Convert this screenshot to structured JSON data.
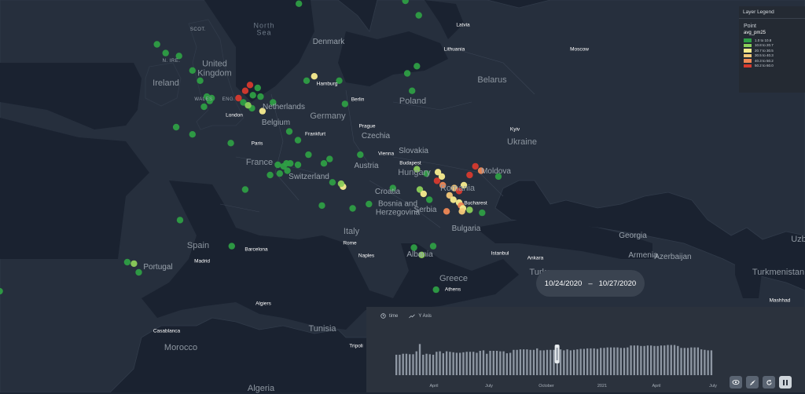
{
  "map": {
    "country_labels": [
      {
        "id": "north-sea",
        "text": "North\nSea",
        "kind": "sea"
      },
      {
        "id": "denmark",
        "text": "Denmark",
        "kind": "country"
      },
      {
        "id": "latvia",
        "text": "Latvia",
        "kind": "city"
      },
      {
        "id": "lithuania",
        "text": "Lithuania",
        "kind": "city"
      },
      {
        "id": "scot",
        "text": "SCOT.",
        "kind": "region"
      },
      {
        "id": "n-ire",
        "text": "N. IRE.",
        "kind": "region"
      },
      {
        "id": "wales",
        "text": "WALES",
        "kind": "region"
      },
      {
        "id": "eng",
        "text": "ENG.",
        "kind": "region"
      },
      {
        "id": "united-kingdom",
        "text": "United\nKingdom",
        "kind": "country-lg"
      },
      {
        "id": "ireland",
        "text": "Ireland",
        "kind": "country-lg"
      },
      {
        "id": "belarus",
        "text": "Belarus",
        "kind": "country-lg"
      },
      {
        "id": "poland",
        "text": "Poland",
        "kind": "country-lg"
      },
      {
        "id": "germany",
        "text": "Germany",
        "kind": "country-lg"
      },
      {
        "id": "netherlands",
        "text": "Netherlands",
        "kind": "country"
      },
      {
        "id": "belgium",
        "text": "Belgium",
        "kind": "country"
      },
      {
        "id": "czechia",
        "text": "Czechia",
        "kind": "country"
      },
      {
        "id": "slovakia",
        "text": "Slovakia",
        "kind": "country"
      },
      {
        "id": "ukraine",
        "text": "Ukraine",
        "kind": "country-lg"
      },
      {
        "id": "france",
        "text": "France",
        "kind": "country-lg"
      },
      {
        "id": "austria",
        "text": "Austria",
        "kind": "country"
      },
      {
        "id": "switzerland",
        "text": "Switzerland",
        "kind": "country"
      },
      {
        "id": "hungary",
        "text": "Hungary",
        "kind": "country-lg"
      },
      {
        "id": "romania",
        "text": "Romania",
        "kind": "country-lg"
      },
      {
        "id": "moldova",
        "text": "Moldova",
        "kind": "country"
      },
      {
        "id": "croatia",
        "text": "Croatia",
        "kind": "country"
      },
      {
        "id": "bosnia",
        "text": "Bosnia and\nHerzegovina",
        "kind": "country"
      },
      {
        "id": "serbia",
        "text": "Serbia",
        "kind": "country"
      },
      {
        "id": "bulgaria",
        "text": "Bulgaria",
        "kind": "country"
      },
      {
        "id": "italy",
        "text": "Italy",
        "kind": "country-lg"
      },
      {
        "id": "spain",
        "text": "Spain",
        "kind": "country-lg"
      },
      {
        "id": "portugal",
        "text": "Portugal",
        "kind": "country"
      },
      {
        "id": "albania",
        "text": "Albania",
        "kind": "country"
      },
      {
        "id": "greece",
        "text": "Greece",
        "kind": "country-lg"
      },
      {
        "id": "turkey",
        "text": "Turkey",
        "kind": "country-lg"
      },
      {
        "id": "georgia",
        "text": "Georgia",
        "kind": "country"
      },
      {
        "id": "armenia",
        "text": "Armenia",
        "kind": "country"
      },
      {
        "id": "azerbaijan",
        "text": "Azerbaijan",
        "kind": "country"
      },
      {
        "id": "turkmenistan",
        "text": "Turkmenistan",
        "kind": "country-lg"
      },
      {
        "id": "morocco",
        "text": "Morocco",
        "kind": "country-lg"
      },
      {
        "id": "tunisia",
        "text": "Tunisia",
        "kind": "country-lg"
      },
      {
        "id": "algeria",
        "text": "Algeria",
        "kind": "country-lg"
      },
      {
        "id": "uzbek",
        "text": "Uzb",
        "kind": "country-lg"
      }
    ],
    "city_labels": [
      {
        "id": "moscow",
        "text": "Moscow"
      },
      {
        "id": "hamburg",
        "text": "Hamburg"
      },
      {
        "id": "berlin",
        "text": "Berlin"
      },
      {
        "id": "london",
        "text": "London"
      },
      {
        "id": "prague",
        "text": "Prague"
      },
      {
        "id": "frankfurt",
        "text": "Frankfurt"
      },
      {
        "id": "kyiv",
        "text": "Kyiv"
      },
      {
        "id": "paris",
        "text": "Paris"
      },
      {
        "id": "vienna",
        "text": "Vienna"
      },
      {
        "id": "budapest",
        "text": "Budapest"
      },
      {
        "id": "bucharest",
        "text": "Bucharest"
      },
      {
        "id": "madrid",
        "text": "Madrid"
      },
      {
        "id": "barcelona",
        "text": "Barcelona"
      },
      {
        "id": "rome",
        "text": "Rome"
      },
      {
        "id": "naples",
        "text": "Naples"
      },
      {
        "id": "istanbul",
        "text": "Istanbul"
      },
      {
        "id": "ankara",
        "text": "Ankara"
      },
      {
        "id": "athens",
        "text": "Athens"
      },
      {
        "id": "algiers",
        "text": "Algiers"
      },
      {
        "id": "casablanca",
        "text": "Casablanca"
      },
      {
        "id": "tripoli",
        "text": "Tripoli"
      },
      {
        "id": "mashhad",
        "text": "Mashhad"
      }
    ],
    "points": [
      {
        "lon": 19.2,
        "lat": 69.6,
        "bin": 0
      },
      {
        "lon": 19.0,
        "lat": 69.9,
        "bin": 0
      },
      {
        "lon": 18.3,
        "lat": 67.4,
        "bin": 0
      },
      {
        "lon": 9.8,
        "lat": 64.1,
        "bin": 0
      },
      {
        "lon": 14.5,
        "lat": 63.2,
        "bin": 0
      },
      {
        "lon": 13.8,
        "lat": 62.5,
        "bin": 0
      },
      {
        "lon": 1.0,
        "lat": 70.9,
        "bin": 0
      },
      {
        "lon": 9.5,
        "lat": 59.9,
        "bin": 0
      },
      {
        "lon": 9.2,
        "lat": 58.3,
        "bin": 0
      },
      {
        "lon": 20.3,
        "lat": 58.5,
        "bin": 0
      },
      {
        "lon": 21.7,
        "lat": 57.5,
        "bin": 0
      },
      {
        "lon": 21.5,
        "lat": 54.0,
        "bin": 0
      },
      {
        "lon": 20.5,
        "lat": 53.5,
        "bin": 0
      },
      {
        "lon": -5.6,
        "lat": 55.5,
        "bin": 0
      },
      {
        "lon": -4.7,
        "lat": 54.9,
        "bin": 0
      },
      {
        "lon": -3.3,
        "lat": 54.7,
        "bin": 0
      },
      {
        "lon": -1.9,
        "lat": 53.7,
        "bin": 0
      },
      {
        "lon": -1.1,
        "lat": 53.0,
        "bin": 0
      },
      {
        "lon": -0.4,
        "lat": 51.9,
        "bin": 0
      },
      {
        "lon": -0.1,
        "lat": 51.6,
        "bin": 0
      },
      {
        "lon": 0.1,
        "lat": 51.8,
        "bin": 0
      },
      {
        "lon": -0.7,
        "lat": 51.2,
        "bin": 0
      },
      {
        "lon": 2.9,
        "lat": 51.8,
        "bin": 5
      },
      {
        "lon": 3.6,
        "lat": 52.3,
        "bin": 5
      },
      {
        "lon": 4.1,
        "lat": 52.7,
        "bin": 5
      },
      {
        "lon": 3.4,
        "lat": 51.5,
        "bin": 0
      },
      {
        "lon": 4.4,
        "lat": 52.0,
        "bin": 0
      },
      {
        "lon": 4.9,
        "lat": 52.5,
        "bin": 0
      },
      {
        "lon": 5.2,
        "lat": 51.9,
        "bin": 0
      },
      {
        "lon": 4.3,
        "lat": 51.1,
        "bin": 0
      },
      {
        "lon": 5.4,
        "lat": 50.9,
        "bin": 2
      },
      {
        "lon": 3.9,
        "lat": 51.3,
        "bin": 1
      },
      {
        "lon": 6.5,
        "lat": 51.5,
        "bin": 0
      },
      {
        "lon": 10.0,
        "lat": 53.0,
        "bin": 0
      },
      {
        "lon": 10.8,
        "lat": 53.3,
        "bin": 2
      },
      {
        "lon": 13.4,
        "lat": 53.0,
        "bin": 0
      },
      {
        "lon": 14.0,
        "lat": 51.4,
        "bin": 0
      },
      {
        "lon": 21.0,
        "lat": 52.3,
        "bin": 0
      },
      {
        "lon": -3.6,
        "lat": 49.8,
        "bin": 0
      },
      {
        "lon": -1.9,
        "lat": 49.3,
        "bin": 0
      },
      {
        "lon": 2.1,
        "lat": 48.7,
        "bin": 0
      },
      {
        "lon": 8.2,
        "lat": 49.5,
        "bin": 0
      },
      {
        "lon": 9.1,
        "lat": 48.9,
        "bin": 0
      },
      {
        "lon": 10.2,
        "lat": 47.9,
        "bin": 0
      },
      {
        "lon": 9.1,
        "lat": 47.2,
        "bin": 0
      },
      {
        "lon": 8.3,
        "lat": 47.3,
        "bin": 0
      },
      {
        "lon": 7.6,
        "lat": 47.1,
        "bin": 0
      },
      {
        "lon": 7.9,
        "lat": 47.3,
        "bin": 0
      },
      {
        "lon": 8.0,
        "lat": 46.8,
        "bin": 0
      },
      {
        "lon": 7.2,
        "lat": 46.6,
        "bin": 0
      },
      {
        "lon": 7.0,
        "lat": 47.2,
        "bin": 0
      },
      {
        "lon": 6.2,
        "lat": 46.5,
        "bin": 0
      },
      {
        "lon": 12.4,
        "lat": 47.6,
        "bin": 0
      },
      {
        "lon": 11.8,
        "lat": 47.3,
        "bin": 0
      },
      {
        "lon": 15.6,
        "lat": 47.9,
        "bin": 0
      },
      {
        "lon": 19.0,
        "lat": 45.6,
        "bin": 0
      },
      {
        "lon": 13.8,
        "lat": 45.7,
        "bin": 2
      },
      {
        "lon": 13.6,
        "lat": 45.9,
        "bin": 1
      },
      {
        "lon": 12.7,
        "lat": 46.0,
        "bin": 0
      },
      {
        "lon": 14.8,
        "lat": 44.2,
        "bin": 0
      },
      {
        "lon": 16.5,
        "lat": 44.5,
        "bin": 0
      },
      {
        "lon": 11.6,
        "lat": 44.4,
        "bin": 0
      },
      {
        "lon": 3.6,
        "lat": 45.5,
        "bin": 0
      },
      {
        "lon": -3.2,
        "lat": 43.4,
        "bin": 0
      },
      {
        "lon": 2.2,
        "lat": 41.6,
        "bin": 0
      },
      {
        "lon": -8.7,
        "lat": 40.5,
        "bin": 0
      },
      {
        "lon": -8.0,
        "lat": 40.4,
        "bin": 1
      },
      {
        "lon": -7.5,
        "lat": 39.8,
        "bin": 0
      },
      {
        "lon": -22.0,
        "lat": 38.5,
        "bin": 0
      },
      {
        "lon": 21.5,
        "lat": 46.9,
        "bin": 1
      },
      {
        "lon": 22.5,
        "lat": 46.6,
        "bin": 0
      },
      {
        "lon": 23.7,
        "lat": 46.7,
        "bin": 2
      },
      {
        "lon": 23.6,
        "lat": 46.1,
        "bin": 5
      },
      {
        "lon": 24.1,
        "lat": 46.4,
        "bin": 2
      },
      {
        "lon": 24.2,
        "lat": 45.8,
        "bin": 4
      },
      {
        "lon": 25.4,
        "lat": 45.6,
        "bin": 3
      },
      {
        "lon": 25.9,
        "lat": 45.4,
        "bin": 5
      },
      {
        "lon": 26.4,
        "lat": 45.8,
        "bin": 2
      },
      {
        "lon": 27.0,
        "lat": 46.5,
        "bin": 5
      },
      {
        "lon": 27.6,
        "lat": 47.1,
        "bin": 5
      },
      {
        "lon": 28.2,
        "lat": 46.8,
        "bin": 4
      },
      {
        "lon": 30.0,
        "lat": 46.4,
        "bin": 0
      },
      {
        "lon": 21.8,
        "lat": 45.5,
        "bin": 1
      },
      {
        "lon": 22.2,
        "lat": 45.2,
        "bin": 2
      },
      {
        "lon": 24.9,
        "lat": 45.1,
        "bin": 3
      },
      {
        "lon": 25.3,
        "lat": 44.8,
        "bin": 2
      },
      {
        "lon": 25.9,
        "lat": 44.6,
        "bin": 2
      },
      {
        "lon": 26.1,
        "lat": 44.4,
        "bin": 4
      },
      {
        "lon": 26.3,
        "lat": 44.2,
        "bin": 2
      },
      {
        "lon": 26.2,
        "lat": 44.0,
        "bin": 3
      },
      {
        "lon": 24.6,
        "lat": 44.0,
        "bin": 4
      },
      {
        "lon": 27.0,
        "lat": 44.1,
        "bin": 1
      },
      {
        "lon": 28.3,
        "lat": 43.9,
        "bin": 0
      },
      {
        "lon": 22.8,
        "lat": 44.8,
        "bin": 0
      },
      {
        "lon": 21.2,
        "lat": 41.5,
        "bin": 0
      },
      {
        "lon": 22.0,
        "lat": 41.0,
        "bin": 1
      },
      {
        "lon": 23.2,
        "lat": 41.6,
        "bin": 0
      },
      {
        "lon": 23.5,
        "lat": 38.6,
        "bin": 0
      }
    ],
    "dot_colors": [
      "#2e9e45",
      "#8ccf5a",
      "#f7ec8e",
      "#f3c878",
      "#ee8855",
      "#d63a2e"
    ]
  },
  "legend": {
    "title": "Layer Legend",
    "layer": "Point",
    "field": "avg_pm25",
    "bins": [
      {
        "label": "1.0 to 10.8",
        "color": "#2e9e45"
      },
      {
        "label": "10.8 to 20.7",
        "color": "#8ccf5a"
      },
      {
        "label": "20.7 to 30.5",
        "color": "#f7ec8e"
      },
      {
        "label": "30.5 to 40.3",
        "color": "#f3c878"
      },
      {
        "label": "40.3 to 50.2",
        "color": "#ee8855"
      },
      {
        "label": "50.2 to 60.0",
        "color": "#d63a2e"
      }
    ]
  },
  "date_range": {
    "start": "10/24/2020",
    "sep": "–",
    "end": "10/27/2020"
  },
  "timeline": {
    "tab_time": "time",
    "tab_yaxis": "Y Axis",
    "axis_labels": [
      "April",
      "July",
      "October",
      "2021",
      "April",
      "July"
    ],
    "bars": [
      0.84,
      0.84,
      0.88,
      0.88,
      0.86,
      0.86,
      0.98,
      1.28,
      0.84,
      0.88,
      0.86,
      0.84,
      0.96,
      0.98,
      0.9,
      0.98,
      0.96,
      0.94,
      0.92,
      0.92,
      0.94,
      0.96,
      0.96,
      0.96,
      0.92,
      1.0,
      1.02,
      0.88,
      1.0,
      1.0,
      1.0,
      0.98,
      0.98,
      0.9,
      0.92,
      1.04,
      1.04,
      1.06,
      1.06,
      1.06,
      1.04,
      1.04,
      1.1,
      1.02,
      1.02,
      1.04,
      1.04,
      1.04,
      1.04,
      1.06,
      1.02,
      1.06,
      1.02,
      1.04,
      1.06,
      1.08,
      1.08,
      1.1,
      1.1,
      1.1,
      1.08,
      1.12,
      1.12,
      1.14,
      1.14,
      1.14,
      1.14,
      1.12,
      1.12,
      1.14,
      1.22,
      1.22,
      1.22,
      1.2,
      1.2,
      1.22,
      1.22,
      1.2,
      1.2,
      1.22,
      1.22,
      1.24,
      1.24,
      1.24,
      1.2,
      1.12,
      1.12,
      1.12,
      1.14,
      1.14,
      1.14,
      1.06,
      1.04,
      1.02,
      1.02
    ],
    "selected_index": 48
  }
}
